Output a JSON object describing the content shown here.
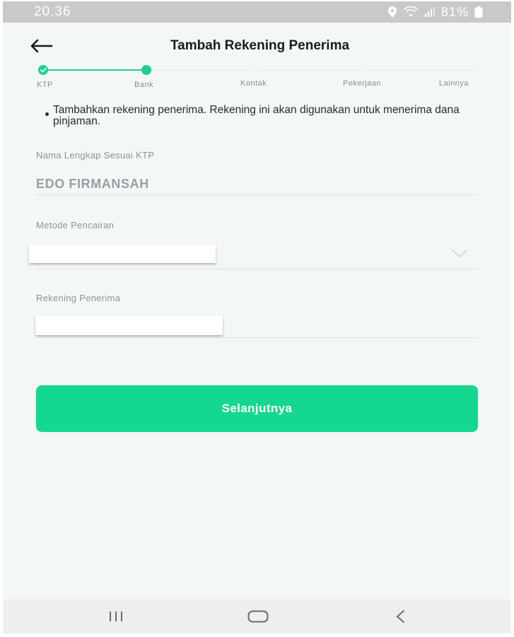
{
  "status_bar": {
    "time": "20.36",
    "battery": "81%"
  },
  "header": {
    "title": "Tambah Rekening Penerima",
    "back_icon": "arrow-left-icon"
  },
  "stepper": {
    "steps": [
      "KTP",
      "Bank",
      "Kontak",
      "Pekerjaan",
      "Lainnya"
    ],
    "current_step": "Bank"
  },
  "info_text": "Tambahkan rekening penerima. Rekening ini akan digunakan untuk menerima dana pinjaman.",
  "form": {
    "name_label": "Nama Lengkap Sesuai KTP",
    "name_value": "EDO FIRMANSAH",
    "method_label": "Metode Pencairan",
    "account_label": "Rekening Penerima"
  },
  "next_button": "Selanjutnya",
  "colors": {
    "accent": "#14d88f",
    "step_done": "#1fcf91"
  },
  "nav_bar": {
    "recents_icon": "recents-icon",
    "home_icon": "home-icon",
    "back_icon": "back-chevron-icon"
  }
}
